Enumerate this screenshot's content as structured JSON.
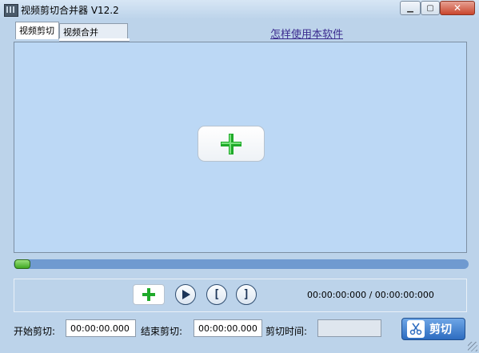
{
  "window": {
    "title": "视频剪切合并器 V12.2"
  },
  "tabs": [
    {
      "label": "视频剪切"
    },
    {
      "label": "视频合并"
    }
  ],
  "help_link": "怎样使用本软件",
  "player": {
    "time_readout": "00:00:00:000 / 00:00:00:000",
    "progress": 0
  },
  "cut": {
    "start_label": "开始剪切:",
    "start_value": "00:00:00.000",
    "end_label": "结束剪切:",
    "end_value": "00:00:00.000",
    "duration_label": "剪切时间:",
    "duration_value": "",
    "button_label": "剪切"
  },
  "colors": {
    "accent_blue": "#2d6cc0",
    "add_green": "#1faa2a",
    "window_bg": "#bcd3ea"
  },
  "icons": [
    "app-icon",
    "add-video-icon",
    "add-icon",
    "play-icon",
    "mark-in-icon",
    "mark-out-icon",
    "scissors-icon"
  ]
}
